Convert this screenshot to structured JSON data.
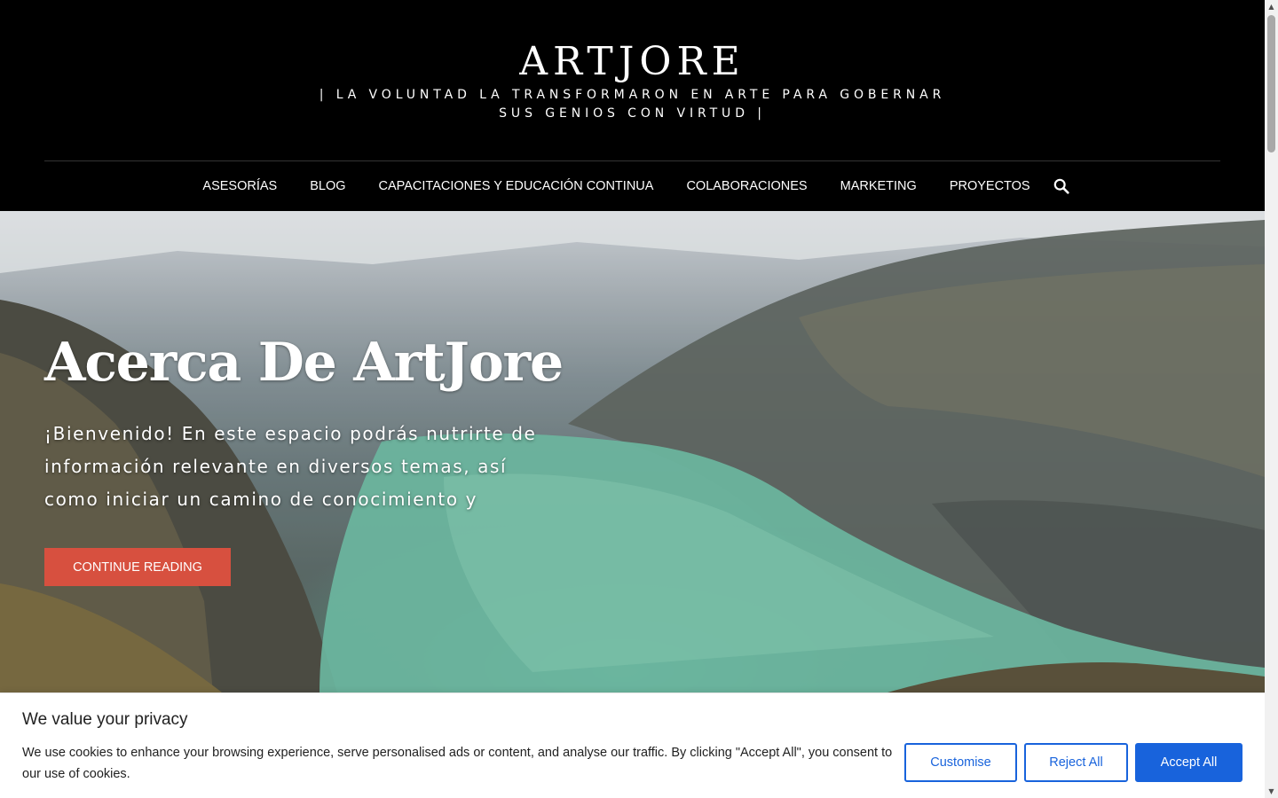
{
  "header": {
    "site_title": "ARTJORE",
    "tagline": "| LA VOLUNTAD LA TRANSFORMARON EN ARTE PARA GOBERNAR SUS GENIOS CON VIRTUD |"
  },
  "nav": {
    "items": [
      {
        "label": "ASESORÍAS"
      },
      {
        "label": "BLOG"
      },
      {
        "label": "CAPACITACIONES Y EDUCACIÓN CONTINUA"
      },
      {
        "label": "COLABORACIONES"
      },
      {
        "label": "MARKETING"
      },
      {
        "label": "PROYECTOS"
      }
    ],
    "search_icon": "search-icon"
  },
  "hero": {
    "title": "Acerca De ArtJore",
    "excerpt": "¡Bienvenido! En este espacio podrás nutrirte de información relevante en diversos temas, así como iniciar un camino de conocimiento y",
    "button_label": "CONTINUE READING",
    "button_color": "#d7503f"
  },
  "cookie": {
    "title": "We value your privacy",
    "text": "We use cookies to enhance your browsing experience, serve personalised ads or content, and analyse our traffic. By clicking \"Accept All\", you consent to our use of cookies.",
    "customise_label": "Customise",
    "reject_label": "Reject All",
    "accept_label": "Accept All",
    "accent_color": "#1863dc"
  },
  "colors": {
    "header_bg": "#000000",
    "banner_bg": "#ffffff"
  }
}
